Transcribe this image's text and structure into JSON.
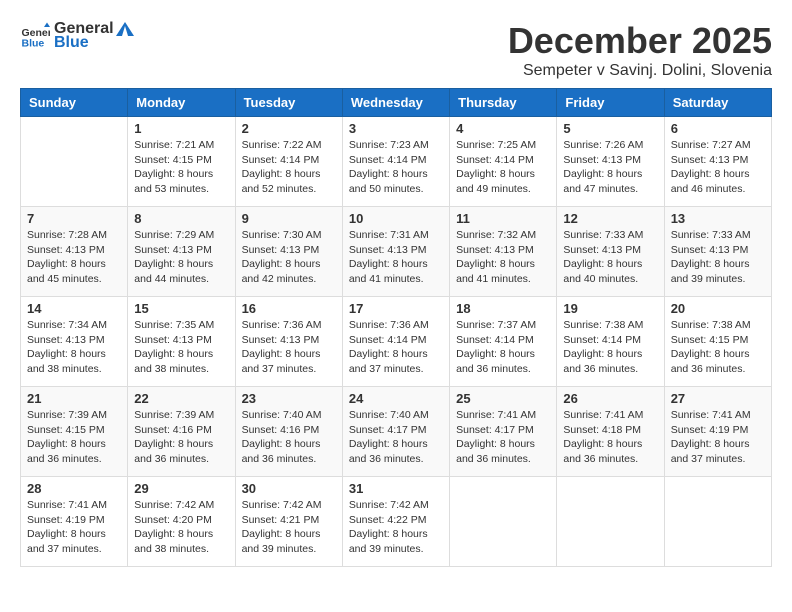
{
  "header": {
    "logo_general": "General",
    "logo_blue": "Blue",
    "month_year": "December 2025",
    "location": "Sempeter v Savinj. Dolini, Slovenia"
  },
  "weekdays": [
    "Sunday",
    "Monday",
    "Tuesday",
    "Wednesday",
    "Thursday",
    "Friday",
    "Saturday"
  ],
  "weeks": [
    [
      {
        "day": "",
        "sunrise": "",
        "sunset": "",
        "daylight": ""
      },
      {
        "day": "1",
        "sunrise": "Sunrise: 7:21 AM",
        "sunset": "Sunset: 4:15 PM",
        "daylight": "Daylight: 8 hours and 53 minutes."
      },
      {
        "day": "2",
        "sunrise": "Sunrise: 7:22 AM",
        "sunset": "Sunset: 4:14 PM",
        "daylight": "Daylight: 8 hours and 52 minutes."
      },
      {
        "day": "3",
        "sunrise": "Sunrise: 7:23 AM",
        "sunset": "Sunset: 4:14 PM",
        "daylight": "Daylight: 8 hours and 50 minutes."
      },
      {
        "day": "4",
        "sunrise": "Sunrise: 7:25 AM",
        "sunset": "Sunset: 4:14 PM",
        "daylight": "Daylight: 8 hours and 49 minutes."
      },
      {
        "day": "5",
        "sunrise": "Sunrise: 7:26 AM",
        "sunset": "Sunset: 4:13 PM",
        "daylight": "Daylight: 8 hours and 47 minutes."
      },
      {
        "day": "6",
        "sunrise": "Sunrise: 7:27 AM",
        "sunset": "Sunset: 4:13 PM",
        "daylight": "Daylight: 8 hours and 46 minutes."
      }
    ],
    [
      {
        "day": "7",
        "sunrise": "Sunrise: 7:28 AM",
        "sunset": "Sunset: 4:13 PM",
        "daylight": "Daylight: 8 hours and 45 minutes."
      },
      {
        "day": "8",
        "sunrise": "Sunrise: 7:29 AM",
        "sunset": "Sunset: 4:13 PM",
        "daylight": "Daylight: 8 hours and 44 minutes."
      },
      {
        "day": "9",
        "sunrise": "Sunrise: 7:30 AM",
        "sunset": "Sunset: 4:13 PM",
        "daylight": "Daylight: 8 hours and 42 minutes."
      },
      {
        "day": "10",
        "sunrise": "Sunrise: 7:31 AM",
        "sunset": "Sunset: 4:13 PM",
        "daylight": "Daylight: 8 hours and 41 minutes."
      },
      {
        "day": "11",
        "sunrise": "Sunrise: 7:32 AM",
        "sunset": "Sunset: 4:13 PM",
        "daylight": "Daylight: 8 hours and 41 minutes."
      },
      {
        "day": "12",
        "sunrise": "Sunrise: 7:33 AM",
        "sunset": "Sunset: 4:13 PM",
        "daylight": "Daylight: 8 hours and 40 minutes."
      },
      {
        "day": "13",
        "sunrise": "Sunrise: 7:33 AM",
        "sunset": "Sunset: 4:13 PM",
        "daylight": "Daylight: 8 hours and 39 minutes."
      }
    ],
    [
      {
        "day": "14",
        "sunrise": "Sunrise: 7:34 AM",
        "sunset": "Sunset: 4:13 PM",
        "daylight": "Daylight: 8 hours and 38 minutes."
      },
      {
        "day": "15",
        "sunrise": "Sunrise: 7:35 AM",
        "sunset": "Sunset: 4:13 PM",
        "daylight": "Daylight: 8 hours and 38 minutes."
      },
      {
        "day": "16",
        "sunrise": "Sunrise: 7:36 AM",
        "sunset": "Sunset: 4:13 PM",
        "daylight": "Daylight: 8 hours and 37 minutes."
      },
      {
        "day": "17",
        "sunrise": "Sunrise: 7:36 AM",
        "sunset": "Sunset: 4:14 PM",
        "daylight": "Daylight: 8 hours and 37 minutes."
      },
      {
        "day": "18",
        "sunrise": "Sunrise: 7:37 AM",
        "sunset": "Sunset: 4:14 PM",
        "daylight": "Daylight: 8 hours and 36 minutes."
      },
      {
        "day": "19",
        "sunrise": "Sunrise: 7:38 AM",
        "sunset": "Sunset: 4:14 PM",
        "daylight": "Daylight: 8 hours and 36 minutes."
      },
      {
        "day": "20",
        "sunrise": "Sunrise: 7:38 AM",
        "sunset": "Sunset: 4:15 PM",
        "daylight": "Daylight: 8 hours and 36 minutes."
      }
    ],
    [
      {
        "day": "21",
        "sunrise": "Sunrise: 7:39 AM",
        "sunset": "Sunset: 4:15 PM",
        "daylight": "Daylight: 8 hours and 36 minutes."
      },
      {
        "day": "22",
        "sunrise": "Sunrise: 7:39 AM",
        "sunset": "Sunset: 4:16 PM",
        "daylight": "Daylight: 8 hours and 36 minutes."
      },
      {
        "day": "23",
        "sunrise": "Sunrise: 7:40 AM",
        "sunset": "Sunset: 4:16 PM",
        "daylight": "Daylight: 8 hours and 36 minutes."
      },
      {
        "day": "24",
        "sunrise": "Sunrise: 7:40 AM",
        "sunset": "Sunset: 4:17 PM",
        "daylight": "Daylight: 8 hours and 36 minutes."
      },
      {
        "day": "25",
        "sunrise": "Sunrise: 7:41 AM",
        "sunset": "Sunset: 4:17 PM",
        "daylight": "Daylight: 8 hours and 36 minutes."
      },
      {
        "day": "26",
        "sunrise": "Sunrise: 7:41 AM",
        "sunset": "Sunset: 4:18 PM",
        "daylight": "Daylight: 8 hours and 36 minutes."
      },
      {
        "day": "27",
        "sunrise": "Sunrise: 7:41 AM",
        "sunset": "Sunset: 4:19 PM",
        "daylight": "Daylight: 8 hours and 37 minutes."
      }
    ],
    [
      {
        "day": "28",
        "sunrise": "Sunrise: 7:41 AM",
        "sunset": "Sunset: 4:19 PM",
        "daylight": "Daylight: 8 hours and 37 minutes."
      },
      {
        "day": "29",
        "sunrise": "Sunrise: 7:42 AM",
        "sunset": "Sunset: 4:20 PM",
        "daylight": "Daylight: 8 hours and 38 minutes."
      },
      {
        "day": "30",
        "sunrise": "Sunrise: 7:42 AM",
        "sunset": "Sunset: 4:21 PM",
        "daylight": "Daylight: 8 hours and 39 minutes."
      },
      {
        "day": "31",
        "sunrise": "Sunrise: 7:42 AM",
        "sunset": "Sunset: 4:22 PM",
        "daylight": "Daylight: 8 hours and 39 minutes."
      },
      {
        "day": "",
        "sunrise": "",
        "sunset": "",
        "daylight": ""
      },
      {
        "day": "",
        "sunrise": "",
        "sunset": "",
        "daylight": ""
      },
      {
        "day": "",
        "sunrise": "",
        "sunset": "",
        "daylight": ""
      }
    ]
  ]
}
